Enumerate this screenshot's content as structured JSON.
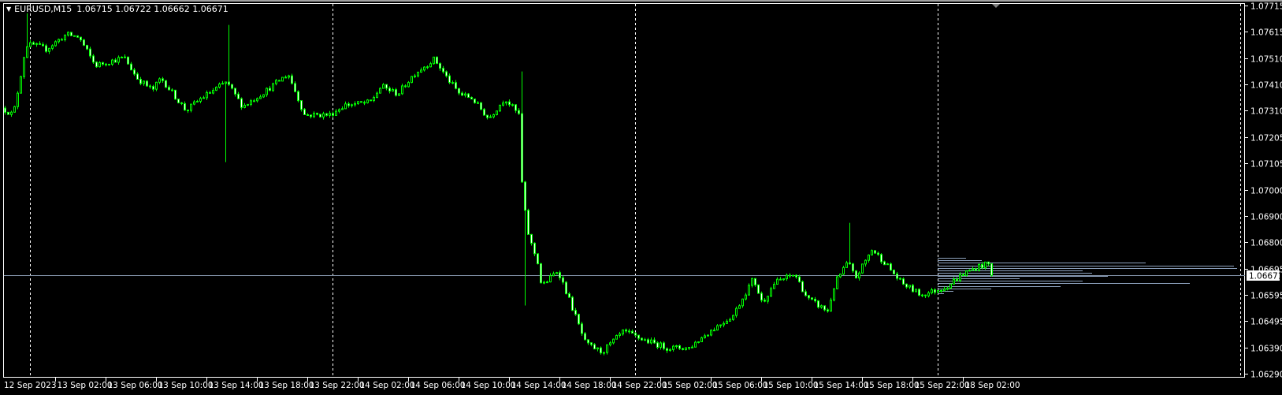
{
  "header": {
    "symbol": "EURUSD,M15",
    "ohlc": "1.06715 1.06722 1.06662 1.06671",
    "menu_icon": "triangle-down-icon"
  },
  "chart_data": {
    "type": "candlestick",
    "symbol": "EURUSD",
    "timeframe": "M15",
    "ylim": [
      1.0629,
      1.07715
    ],
    "current_price": "1.06671",
    "current_price_value": 1.06671,
    "price_ticks": [
      "1.07715",
      "1.07615",
      "1.07510",
      "1.07410",
      "1.07310",
      "1.07205",
      "1.07105",
      "1.07000",
      "1.06900",
      "1.06800",
      "1.06695",
      "1.06595",
      "1.06495",
      "1.06390",
      "1.06290"
    ],
    "time_labels": [
      "12 Sep 2023",
      "13 Sep 02:00",
      "13 Sep 06:00",
      "13 Sep 10:00",
      "13 Sep 14:00",
      "13 Sep 18:00",
      "13 Sep 22:00",
      "14 Sep 02:00",
      "14 Sep 06:00",
      "14 Sep 10:00",
      "14 Sep 14:00",
      "14 Sep 18:00",
      "14 Sep 22:00",
      "15 Sep 02:00",
      "15 Sep 06:00",
      "15 Sep 10:00",
      "15 Sep 14:00",
      "15 Sep 18:00",
      "15 Sep 22:00",
      "18 Sep 02:00"
    ],
    "time_label_step_hours": 4,
    "day_separators_hours": [
      2,
      26,
      50,
      74,
      98
    ],
    "candle_minutes": 15,
    "hours_shown": 78.5,
    "price_path_anchors_hours_price": [
      [
        0,
        1.07318
      ],
      [
        0.9,
        1.07292
      ],
      [
        1.4,
        1.07419
      ],
      [
        1.9,
        1.07562
      ],
      [
        2.55,
        1.07562
      ],
      [
        3.5,
        1.07546
      ],
      [
        5.1,
        1.07603
      ],
      [
        6.1,
        1.07593
      ],
      [
        7.4,
        1.07483
      ],
      [
        9.7,
        1.07514
      ],
      [
        10.7,
        1.07435
      ],
      [
        11.95,
        1.07387
      ],
      [
        12.6,
        1.07435
      ],
      [
        14.6,
        1.07308
      ],
      [
        15.8,
        1.07356
      ],
      [
        17.8,
        1.07419
      ],
      [
        19.1,
        1.07324
      ],
      [
        21.0,
        1.07387
      ],
      [
        22.7,
        1.07451
      ],
      [
        24,
        1.07292
      ],
      [
        26,
        1.07292
      ],
      [
        27.2,
        1.0733
      ],
      [
        29.2,
        1.0734
      ],
      [
        30.1,
        1.07403
      ],
      [
        31.4,
        1.07372
      ],
      [
        32.7,
        1.07451
      ],
      [
        34.3,
        1.07508
      ],
      [
        35.3,
        1.07435
      ],
      [
        36.3,
        1.07372
      ],
      [
        37.3,
        1.07356
      ],
      [
        38.6,
        1.07277
      ],
      [
        39.9,
        1.07356
      ],
      [
        41,
        1.07292
      ],
      [
        41.3,
        1.06976
      ],
      [
        41.8,
        1.06817
      ],
      [
        42.5,
        1.06722
      ],
      [
        42.8,
        1.06627
      ],
      [
        44.1,
        1.06691
      ],
      [
        45.1,
        1.06564
      ],
      [
        46.3,
        1.06405
      ],
      [
        47.6,
        1.06374
      ],
      [
        49.3,
        1.06453
      ],
      [
        50.9,
        1.06421
      ],
      [
        52.8,
        1.0639
      ],
      [
        54.5,
        1.0639
      ],
      [
        56.1,
        1.06453
      ],
      [
        58,
        1.06516
      ],
      [
        59.6,
        1.06659
      ],
      [
        60.3,
        1.06564
      ],
      [
        61.3,
        1.06643
      ],
      [
        62.9,
        1.06675
      ],
      [
        63.9,
        1.0658
      ],
      [
        65.5,
        1.06532
      ],
      [
        66.1,
        1.06643
      ],
      [
        67.1,
        1.06722
      ],
      [
        67.7,
        1.06659
      ],
      [
        69,
        1.0677
      ],
      [
        70,
        1.06722
      ],
      [
        71.3,
        1.06643
      ],
      [
        72.9,
        1.06595
      ],
      [
        74,
        1.06611
      ],
      [
        74.9,
        1.06627
      ],
      [
        76.2,
        1.06675
      ],
      [
        77.5,
        1.06706
      ],
      [
        78.25,
        1.06715
      ],
      [
        78.5,
        1.06671
      ]
    ],
    "wick_extremes_hours": [
      {
        "t": 1.75,
        "high": 1.07685
      },
      {
        "t": 17.5,
        "low": 1.07109
      },
      {
        "t": 17.75,
        "high": 1.0764
      },
      {
        "t": 41.0,
        "high": 1.0746
      },
      {
        "t": 41.25,
        "low": 1.06554
      },
      {
        "t": 67.0,
        "high": 1.06874
      }
    ],
    "volume_profile": [
      {
        "price": 1.06739,
        "volume": 9
      },
      {
        "price": 1.06729,
        "volume": 14
      },
      {
        "price": 1.06719,
        "volume": 66
      },
      {
        "price": 1.06709,
        "volume": 94
      },
      {
        "price": 1.06699,
        "volume": 95
      },
      {
        "price": 1.0669,
        "volume": 46
      },
      {
        "price": 1.06681,
        "volume": 49
      },
      {
        "price": 1.06669,
        "volume": 54
      },
      {
        "price": 1.0666,
        "volume": 26
      },
      {
        "price": 1.0665,
        "volume": 46
      },
      {
        "price": 1.06641,
        "volume": 80
      },
      {
        "price": 1.0663,
        "volume": 39
      },
      {
        "price": 1.0662,
        "volume": 17
      },
      {
        "price": 1.06611,
        "volume": 5
      },
      {
        "price": 1.066,
        "volume": 2
      }
    ],
    "colors": {
      "background": "#000000",
      "candle": "#00ff00",
      "bear_fill": "#ffffff",
      "bull_fill": "#000000",
      "grid": "#ffffff",
      "bid_line": "#8393a8",
      "volume_profile": "#8ea3bf"
    }
  }
}
